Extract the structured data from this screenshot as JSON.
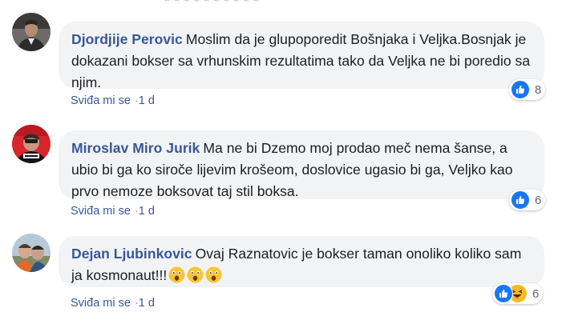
{
  "comments": [
    {
      "author": "Djordjije Perovic",
      "text": "Moslim da je glupoporedit Bošnjaka i Veljka.Bosnjak je dokazani bokser sa vrhunskim rezultatima tako da Veljka ne bi poredio sa njim.",
      "reactions": {
        "count": "8",
        "types": [
          "like-icon"
        ]
      },
      "like_label": "Sviđa mi se",
      "time": "1 d"
    },
    {
      "author": "Miroslav Miro Jurik",
      "text": "Ma ne bi Dzemo moj prodao meč nema šanse, a ubio bi ga ko siroče lijevim krošeom, doslovice ugasio bi ga, Veljko kao prvo nemoze boksovat taj stil boksa.",
      "reactions": {
        "count": "6",
        "types": [
          "like-icon"
        ]
      },
      "like_label": "Sviđa mi se",
      "time": "1 d"
    },
    {
      "author": "Dejan Ljubinkovic",
      "text": "Ovaj Raznatovic je bokser taman onoliko koliko sam ja kosmonaut!!!",
      "emojis": [
        "astonished-face-icon",
        "astonished-face-icon",
        "astonished-face-icon"
      ],
      "reactions": {
        "count": "6",
        "types": [
          "like-icon",
          "haha-icon"
        ]
      },
      "like_label": "Sviđa mi se",
      "time": "1 d"
    }
  ],
  "colors": {
    "author": "#385898",
    "bubble": "#f2f3f5",
    "like": "#1877f2",
    "haha": "#f7b928",
    "meta": "#65676b"
  }
}
